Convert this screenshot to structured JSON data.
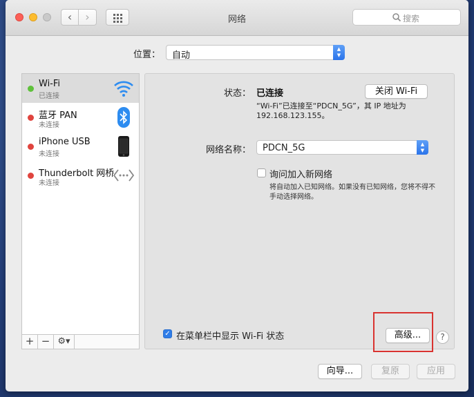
{
  "window": {
    "title": "网络"
  },
  "toolbar": {
    "back_icon": "chevron-left-icon",
    "forward_icon": "chevron-right-icon",
    "show_all_icon": "grid-icon",
    "search_placeholder": "搜索"
  },
  "location": {
    "label": "位置：",
    "value": "自动"
  },
  "services": [
    {
      "name": "Wi-Fi",
      "status": "已连接",
      "status_color": "#5fc13b",
      "icon": "wifi-icon"
    },
    {
      "name": "蓝牙 PAN",
      "status": "未连接",
      "status_color": "#e0443e",
      "icon": "bluetooth-icon"
    },
    {
      "name": "iPhone USB",
      "status": "未连接",
      "status_color": "#e0443e",
      "icon": "iphone-icon"
    },
    {
      "name": "Thunderbolt 网桥",
      "status": "未连接",
      "status_color": "#e0443e",
      "icon": "thunderbolt-bridge-icon"
    }
  ],
  "sidebar_buttons": {
    "add": "+",
    "remove": "−",
    "gear": "⚙▾"
  },
  "detail": {
    "status_label": "状态：",
    "status_value": "已连接",
    "toggle_wifi_button": "关闭 Wi-Fi",
    "status_desc_line1": "“Wi-Fi”已连接至“PDCN_5G”，其 IP 地址为",
    "status_desc_line2": "192.168.123.155。",
    "network_name_label": "网络名称：",
    "network_name_value": "PDCN_5G",
    "ask_join_label": "询问加入新网络",
    "ask_join_checked": false,
    "ask_join_desc": "将自动加入已知网络。如果没有已知网络，您将不得不手动选择网络。",
    "menu_bar_label": "在菜单栏中显示 Wi-Fi 状态",
    "menu_bar_checked": true,
    "advanced_button": "高级...",
    "help_button": "?"
  },
  "footer": {
    "assist_button": "向导...",
    "revert_button": "复原",
    "apply_button": "应用"
  },
  "colors": {
    "accent": "#2f7de8",
    "highlight": "#d9322f"
  }
}
